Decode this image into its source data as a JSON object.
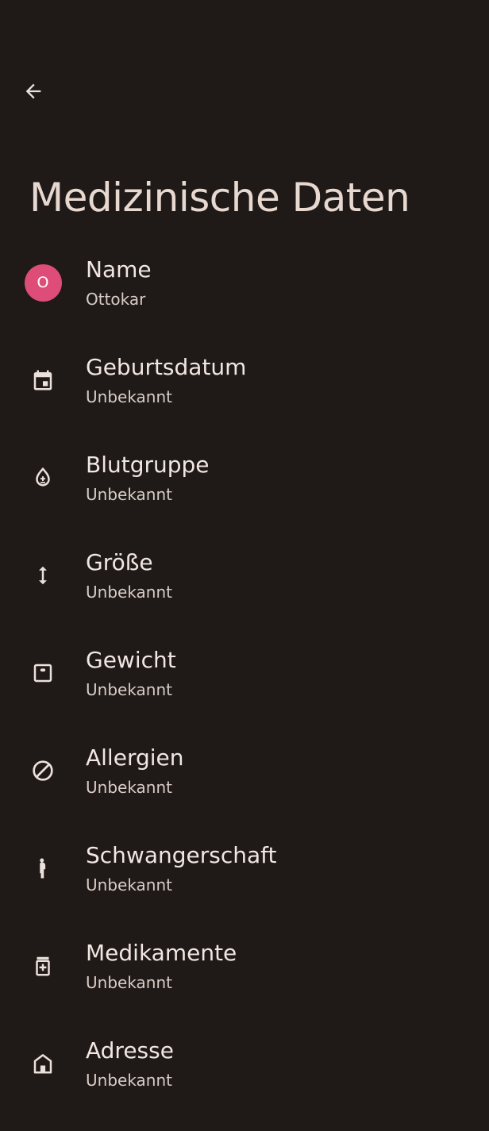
{
  "header": {
    "title": "Medizinische Daten"
  },
  "items": [
    {
      "title": "Name",
      "subtitle": "Ottokar",
      "avatar_letter": "O",
      "icon": "avatar"
    },
    {
      "title": "Geburtsdatum",
      "subtitle": "Unbekannt",
      "icon": "calendar-icon"
    },
    {
      "title": "Blutgruppe",
      "subtitle": "Unbekannt",
      "icon": "blood-drop-icon"
    },
    {
      "title": "Größe",
      "subtitle": "Unbekannt",
      "icon": "height-arrows-icon"
    },
    {
      "title": "Gewicht",
      "subtitle": "Unbekannt",
      "icon": "scale-icon"
    },
    {
      "title": "Allergien",
      "subtitle": "Unbekannt",
      "icon": "block-icon"
    },
    {
      "title": "Schwangerschaft",
      "subtitle": "Unbekannt",
      "icon": "pregnant-woman-icon"
    },
    {
      "title": "Medikamente",
      "subtitle": "Unbekannt",
      "icon": "medication-icon"
    },
    {
      "title": "Adresse",
      "subtitle": "Unbekannt",
      "icon": "home-icon"
    }
  ],
  "colors": {
    "background": "#1f1a18",
    "avatar": "#dd4d78",
    "text": "#f1e6e1"
  }
}
